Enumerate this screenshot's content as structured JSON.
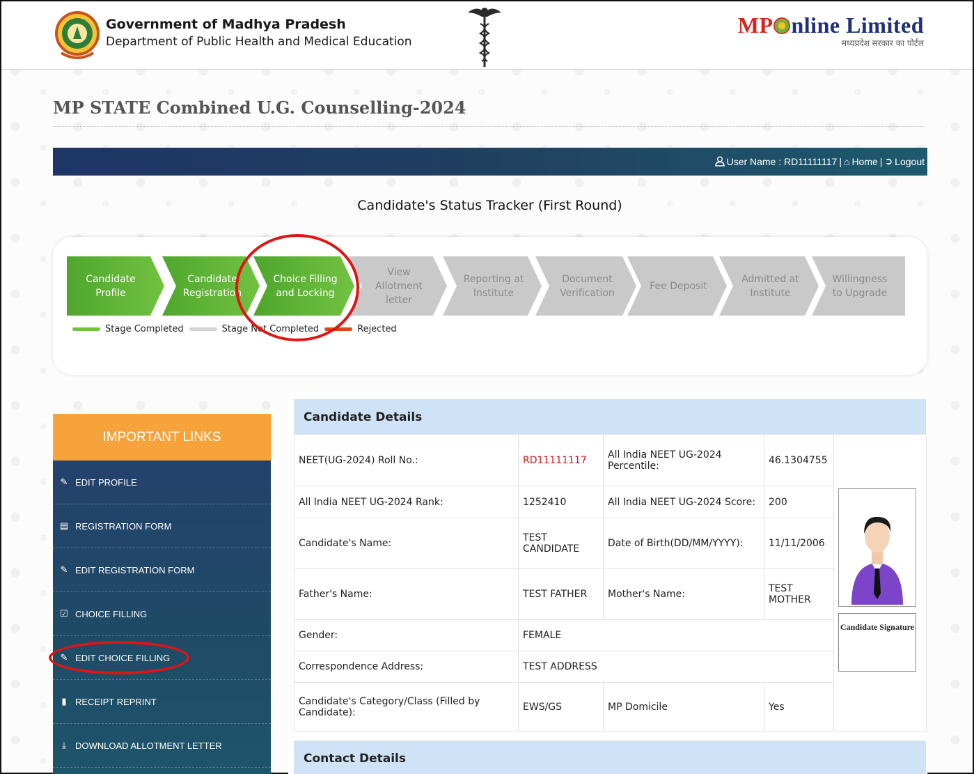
{
  "header": {
    "gov_title": "Government of Madhya Pradesh",
    "gov_subtitle": "Department of Public Health and Medical Education",
    "mp_logo": {
      "prefix": "MP",
      "suffix": "nline Limited",
      "tagline": "मध्यप्रदेश सरकार का पोर्टल"
    }
  },
  "page_title": "MP STATE Combined U.G. Counselling-2024",
  "nav": {
    "user_label": "User Name : RD11111117",
    "sep": "|",
    "home_label": "Home",
    "logout_label": "Logout"
  },
  "tracker": {
    "heading": "Candidate's Status Tracker (First Round)",
    "stages": [
      {
        "label": "Candidate Profile",
        "completed": true
      },
      {
        "label": "Candidate Registration",
        "completed": true
      },
      {
        "label": "Choice Filling and Locking",
        "completed": true
      },
      {
        "label": "View Allotment letter",
        "completed": false
      },
      {
        "label": "Reporting at Institute",
        "completed": false
      },
      {
        "label": "Document Verification",
        "completed": false
      },
      {
        "label": "Fee Deposit",
        "completed": false
      },
      {
        "label": "Admitted at Institute",
        "completed": false
      },
      {
        "label": "Willingness to Upgrade",
        "completed": false
      }
    ],
    "legend": [
      {
        "label": "Stage Completed",
        "color": "#72c241"
      },
      {
        "label": "Stage Not Completed",
        "color": "#cccccc"
      },
      {
        "label": "Rejected",
        "color": "#e0441c"
      }
    ]
  },
  "sidebar": {
    "heading": "IMPORTANT LINKS",
    "items": [
      {
        "label": "EDIT PROFILE",
        "icon": "edit-icon"
      },
      {
        "label": "REGISTRATION FORM",
        "icon": "form-card-icon"
      },
      {
        "label": "EDIT REGISTRATION FORM",
        "icon": "edit-icon"
      },
      {
        "label": "CHOICE FILLING",
        "icon": "checkbox-icon"
      },
      {
        "label": "EDIT CHOICE FILLING",
        "icon": "edit-icon"
      },
      {
        "label": "RECEIPT REPRINT",
        "icon": "document-icon"
      },
      {
        "label": "DOWNLOAD ALLOTMENT LETTER",
        "icon": "download-icon"
      }
    ]
  },
  "details": {
    "heading": "Candidate Details",
    "roll_label": "NEET(UG-2024) Roll No.:",
    "roll_value": "RD11111117",
    "percentile_label": "All India NEET UG-2024 Percentile:",
    "percentile_value": "46.1304755",
    "rank_label": "All India NEET UG-2024 Rank:",
    "rank_value": "1252410",
    "score_label": "All India NEET UG-2024 Score:",
    "score_value": "200",
    "name_label": "Candidate's Name:",
    "name_value": "TEST CANDIDATE",
    "dob_label": "Date of Birth(DD/MM/YYYY):",
    "dob_value": "11/11/2006",
    "father_label": "Father's Name:",
    "father_value": "TEST FATHER",
    "mother_label": "Mother's Name:",
    "mother_value": "TEST MOTHER",
    "gender_label": "Gender:",
    "gender_value": "FEMALE",
    "address_label": "Correspondence Address:",
    "address_value": "TEST ADDRESS",
    "category_label": "Candidate's Category/Class (Filled by Candidate):",
    "category_value": "EWS/GS",
    "domicile_label": "MP Domicile",
    "domicile_value": "Yes",
    "signature_label": "Candidate Signature",
    "contact_heading": "Contact Details"
  }
}
